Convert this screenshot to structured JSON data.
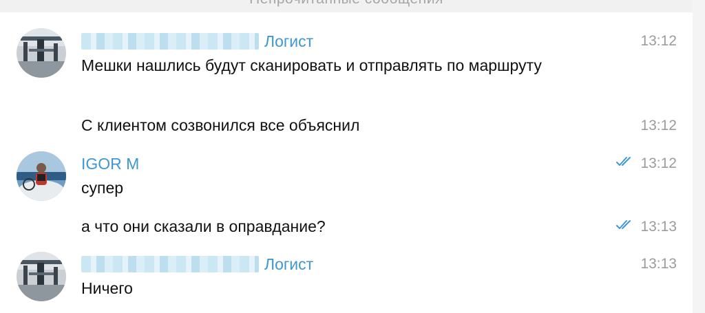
{
  "unread_divider": "Непрочитанные сообщения",
  "messages": [
    {
      "sender": "Логист",
      "text": "Мешки нашлись будут сканировать и отправлять по маршруту",
      "time": "13:12"
    },
    {
      "text": "С клиентом созвонился все объяснил",
      "time": "13:12"
    },
    {
      "sender": "IGOR M",
      "text": "супер",
      "time": "13:12",
      "status": "read"
    },
    {
      "text": "а что они сказали в оправдание?",
      "time": "13:13",
      "status": "read"
    },
    {
      "sender": "Логист",
      "text": "Ничего",
      "time": "13:13"
    }
  ],
  "colors": {
    "sender_name": "#3f97d2",
    "read_check": "#3f97d2",
    "timestamp": "#9b9b9b",
    "text": "#111111"
  },
  "icons": {
    "read_status": "double-check-icon"
  }
}
